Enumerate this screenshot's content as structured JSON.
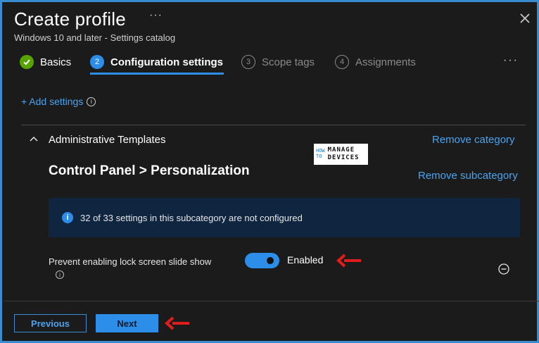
{
  "header": {
    "title": "Create profile",
    "more_label": "···",
    "subtitle": "Windows 10 and later - Settings catalog",
    "close_icon": "close-icon"
  },
  "steps": [
    {
      "number": "✓",
      "label": "Basics",
      "state": "done"
    },
    {
      "number": "2",
      "label": "Configuration settings",
      "state": "active"
    },
    {
      "number": "3",
      "label": "Scope tags",
      "state": "inactive"
    },
    {
      "number": "4",
      "label": "Assignments",
      "state": "inactive"
    }
  ],
  "steps_more_label": "···",
  "add_settings": {
    "label": "+ Add settings",
    "info_glyph": "i"
  },
  "category": {
    "title": "Administrative Templates",
    "remove_label": "Remove category",
    "collapse_icon": "chevron-up-icon"
  },
  "logo": {
    "how": "HOW",
    "to": "TO",
    "line1": "MANAGE",
    "line2": "DEVICES"
  },
  "subcategory": {
    "title": "Control Panel > Personalization",
    "remove_label": "Remove subcategory"
  },
  "info_banner": {
    "glyph": "i",
    "text": "32 of 33 settings in this subcategory are not configured"
  },
  "setting": {
    "name": "Prevent enabling lock screen slide show",
    "info_glyph": "i",
    "toggle_state": "Enabled",
    "toggle_on": true,
    "remove_icon": "minus-circle-icon"
  },
  "footer": {
    "previous_label": "Previous",
    "next_label": "Next"
  },
  "colors": {
    "accent": "#2c8ee8",
    "link": "#4aa3f0",
    "success": "#57a300",
    "annotation_arrow": "#e21c1c",
    "background": "#1b1b1b",
    "banner": "#0f2540"
  }
}
